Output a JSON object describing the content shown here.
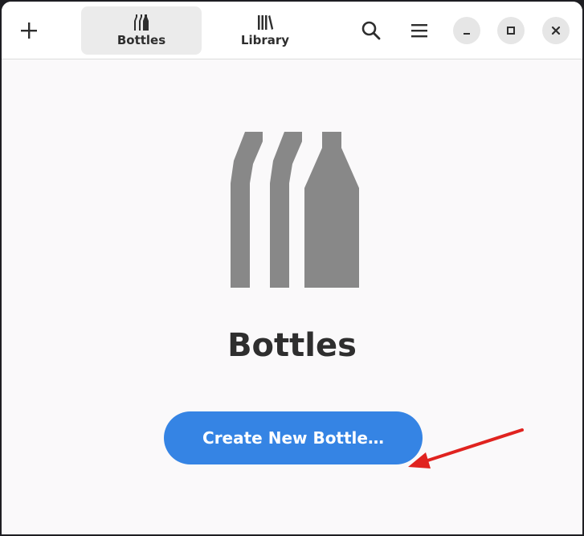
{
  "header": {
    "add_icon": "plus-icon",
    "tabs": [
      {
        "label": "Bottles",
        "icon": "bottles-icon",
        "active": true
      },
      {
        "label": "Library",
        "icon": "library-icon",
        "active": false
      }
    ],
    "search_icon": "search-icon",
    "menu_icon": "hamburger-menu-icon",
    "window_controls": [
      "minimize-icon",
      "maximize-icon",
      "close-icon"
    ]
  },
  "main": {
    "title": "Bottles",
    "create_button_label": "Create New Bottle…",
    "hero_icon": "bottles-icon"
  },
  "colors": {
    "accent": "#3584e4",
    "annotation_arrow": "#e0231f",
    "hero_icon": "#888888"
  }
}
